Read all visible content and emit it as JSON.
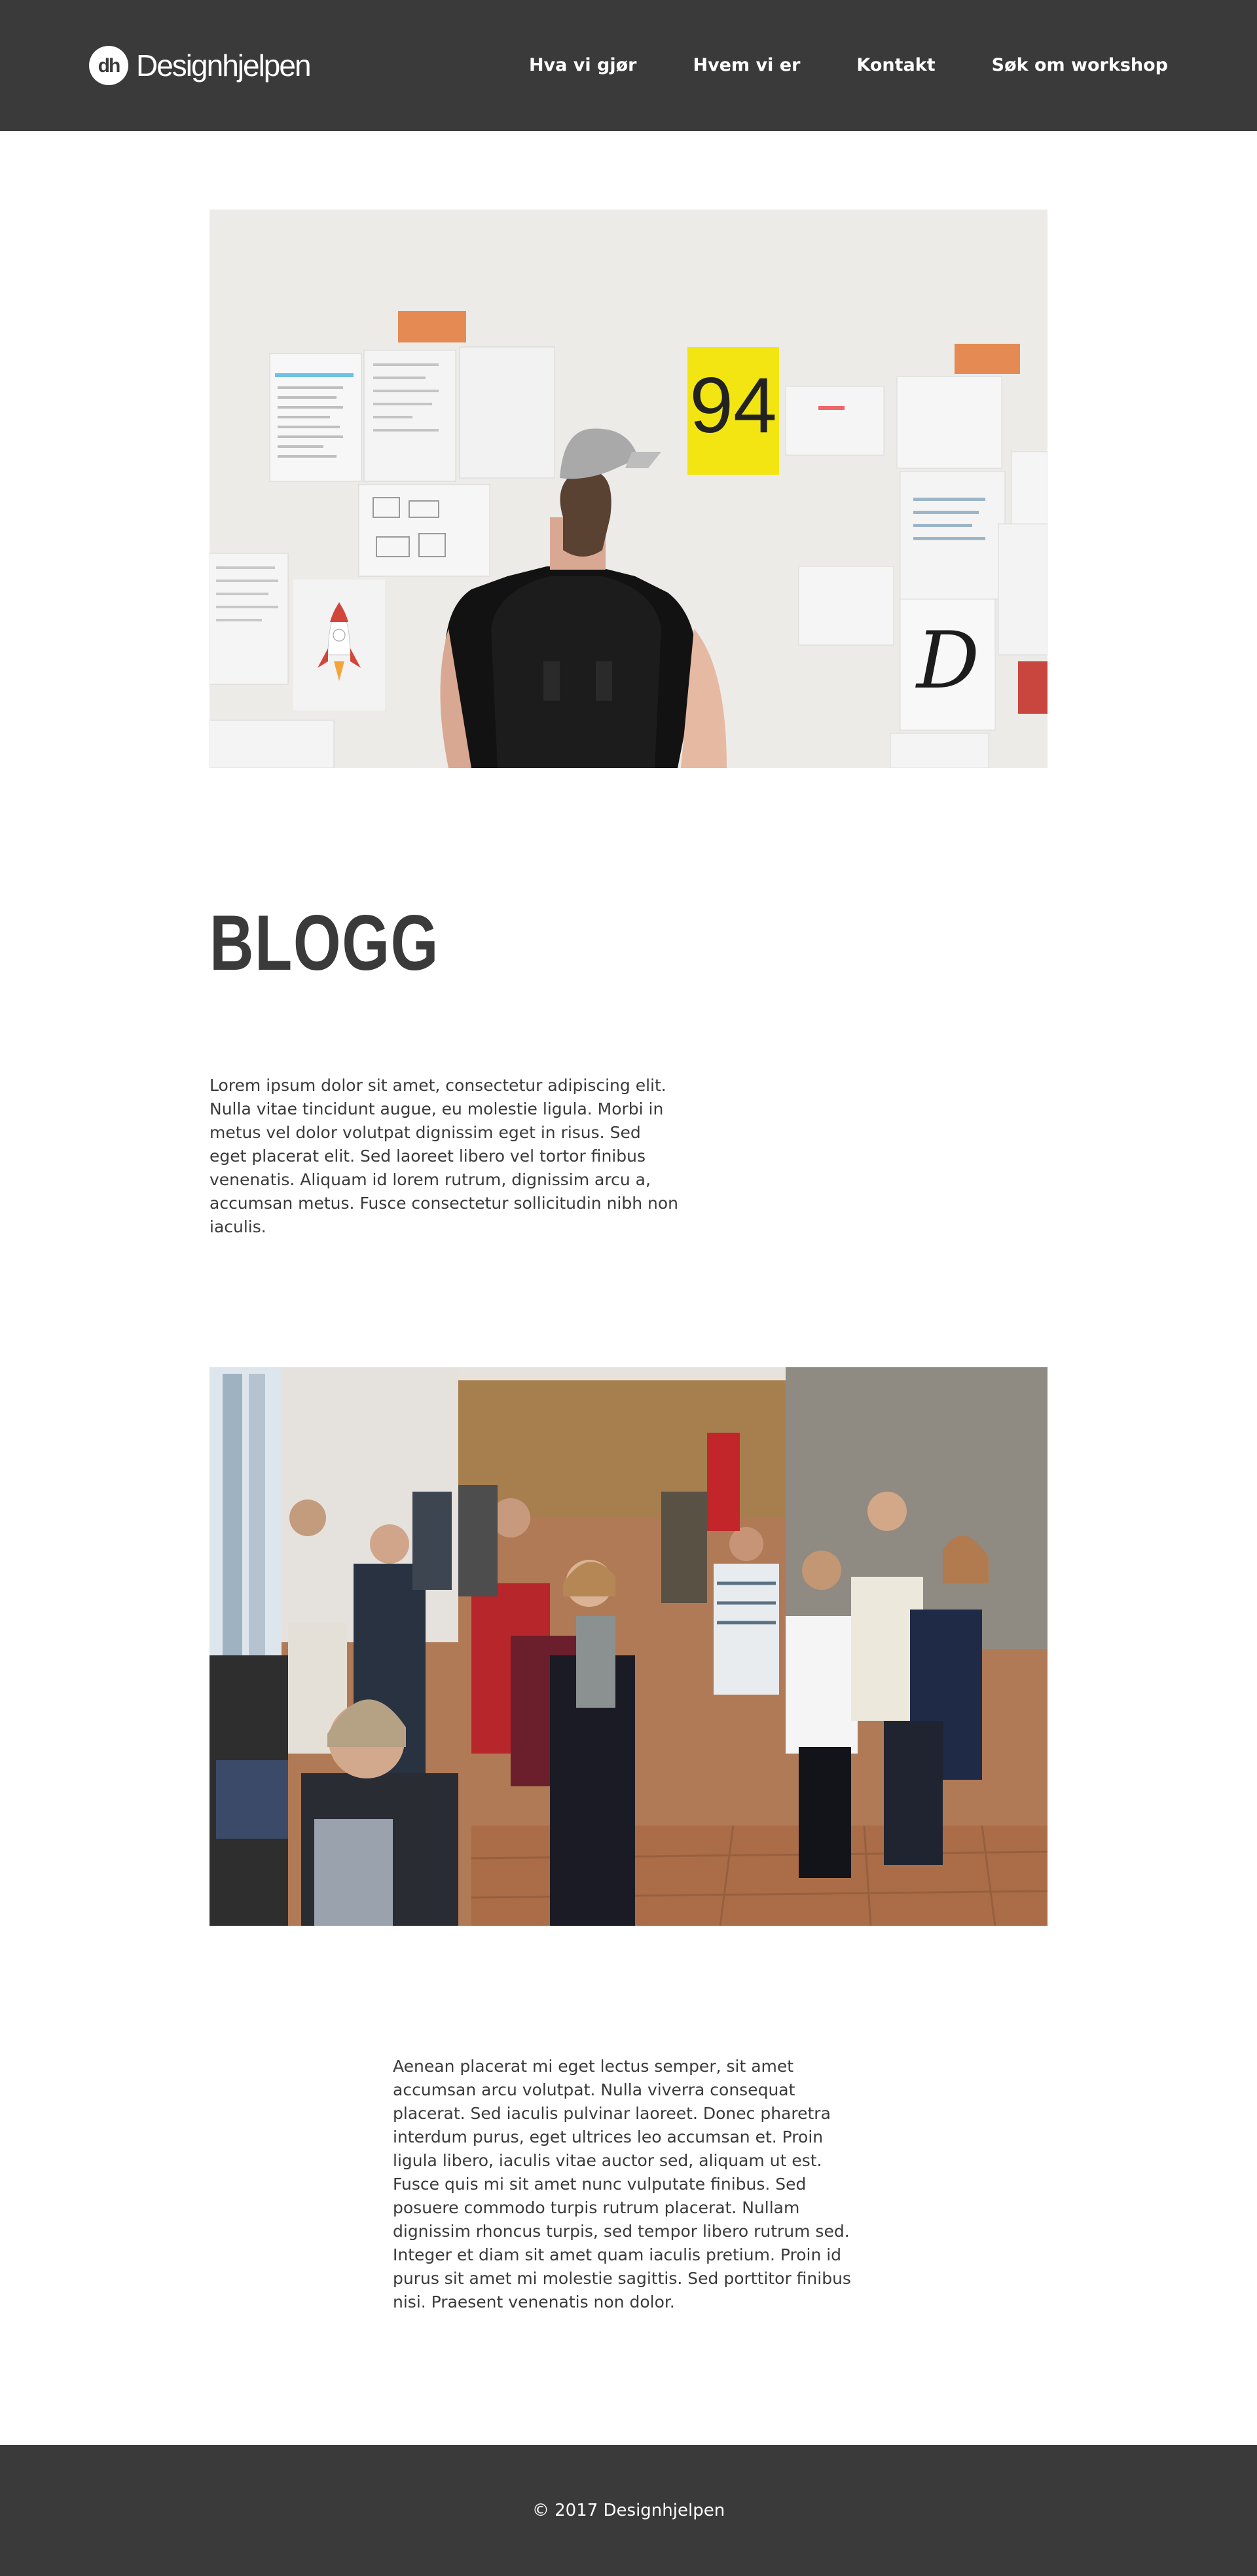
{
  "header": {
    "logo_text": "Designhjelpen",
    "nav": [
      {
        "label": "Hva vi gjør"
      },
      {
        "label": "Hvem vi er"
      },
      {
        "label": "Kontakt"
      },
      {
        "label": "Søk om workshop"
      }
    ]
  },
  "main": {
    "title": "BLOGG",
    "intro": "Lorem ipsum dolor sit amet, consectetur adipiscing elit. Nulla vitae tincidunt augue, eu molestie ligula. Morbi in metus vel dolor volutpat dignissim eget in risus. Sed eget placerat elit. Sed laoreet libero vel tortor finibus venenatis. Aliquam id lorem rutrum, dignissim arcu a, accumsan metus. Fusce consectetur sollicitudin nibh non iaculis.",
    "body": "Aenean placerat mi eget lectus semper, sit amet accumsan arcu volutpat. Nulla viverra consequat placerat. Sed iaculis pulvinar laoreet. Donec pharetra interdum purus, eget ultrices leo accumsan et. Proin ligula libero, iaculis vitae auctor sed, aliquam ut est. Fusce quis mi sit amet nunc vulputate finibus. Sed posuere commodo turpis rutrum placerat. Nullam dignissim rhoncus turpis, sed tempor libero rutrum sed. Integer et diam sit amet quam iaculis pretium. Proin id purus sit amet mi molestie sagittis. Sed porttitor finibus nisi. Praesent venenatis non dolor."
  },
  "footer": {
    "copyright": "© 2017 Designhjelpen"
  },
  "colors": {
    "header_bg": "#3a3a3a",
    "text": "#3a3a3a",
    "page_bg": "#ffffff"
  }
}
